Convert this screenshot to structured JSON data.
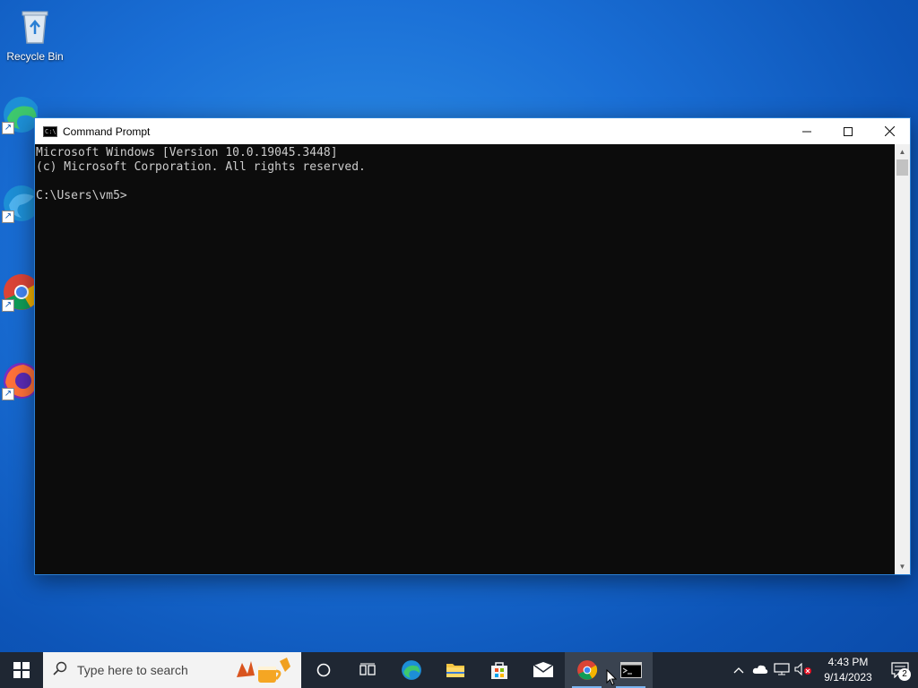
{
  "desktop": {
    "icons": [
      {
        "label": "Recycle Bin"
      },
      {
        "label": "Microsoft Edge"
      },
      {
        "label": "Profile Edge"
      },
      {
        "label": "Google Chrome"
      },
      {
        "label": "Firefox"
      }
    ]
  },
  "window": {
    "title": "Command Prompt",
    "console_lines": [
      "Microsoft Windows [Version 10.0.19045.3448]",
      "(c) Microsoft Corporation. All rights reserved.",
      "",
      "C:\\Users\\vm5>"
    ]
  },
  "taskbar": {
    "search_placeholder": "Type here to search",
    "clock_time": "4:43 PM",
    "clock_date": "9/14/2023",
    "notification_count": "2"
  },
  "colors": {
    "console_bg": "#0c0c0c",
    "console_fg": "#cccccc",
    "taskbar_bg": "#1f2733"
  }
}
